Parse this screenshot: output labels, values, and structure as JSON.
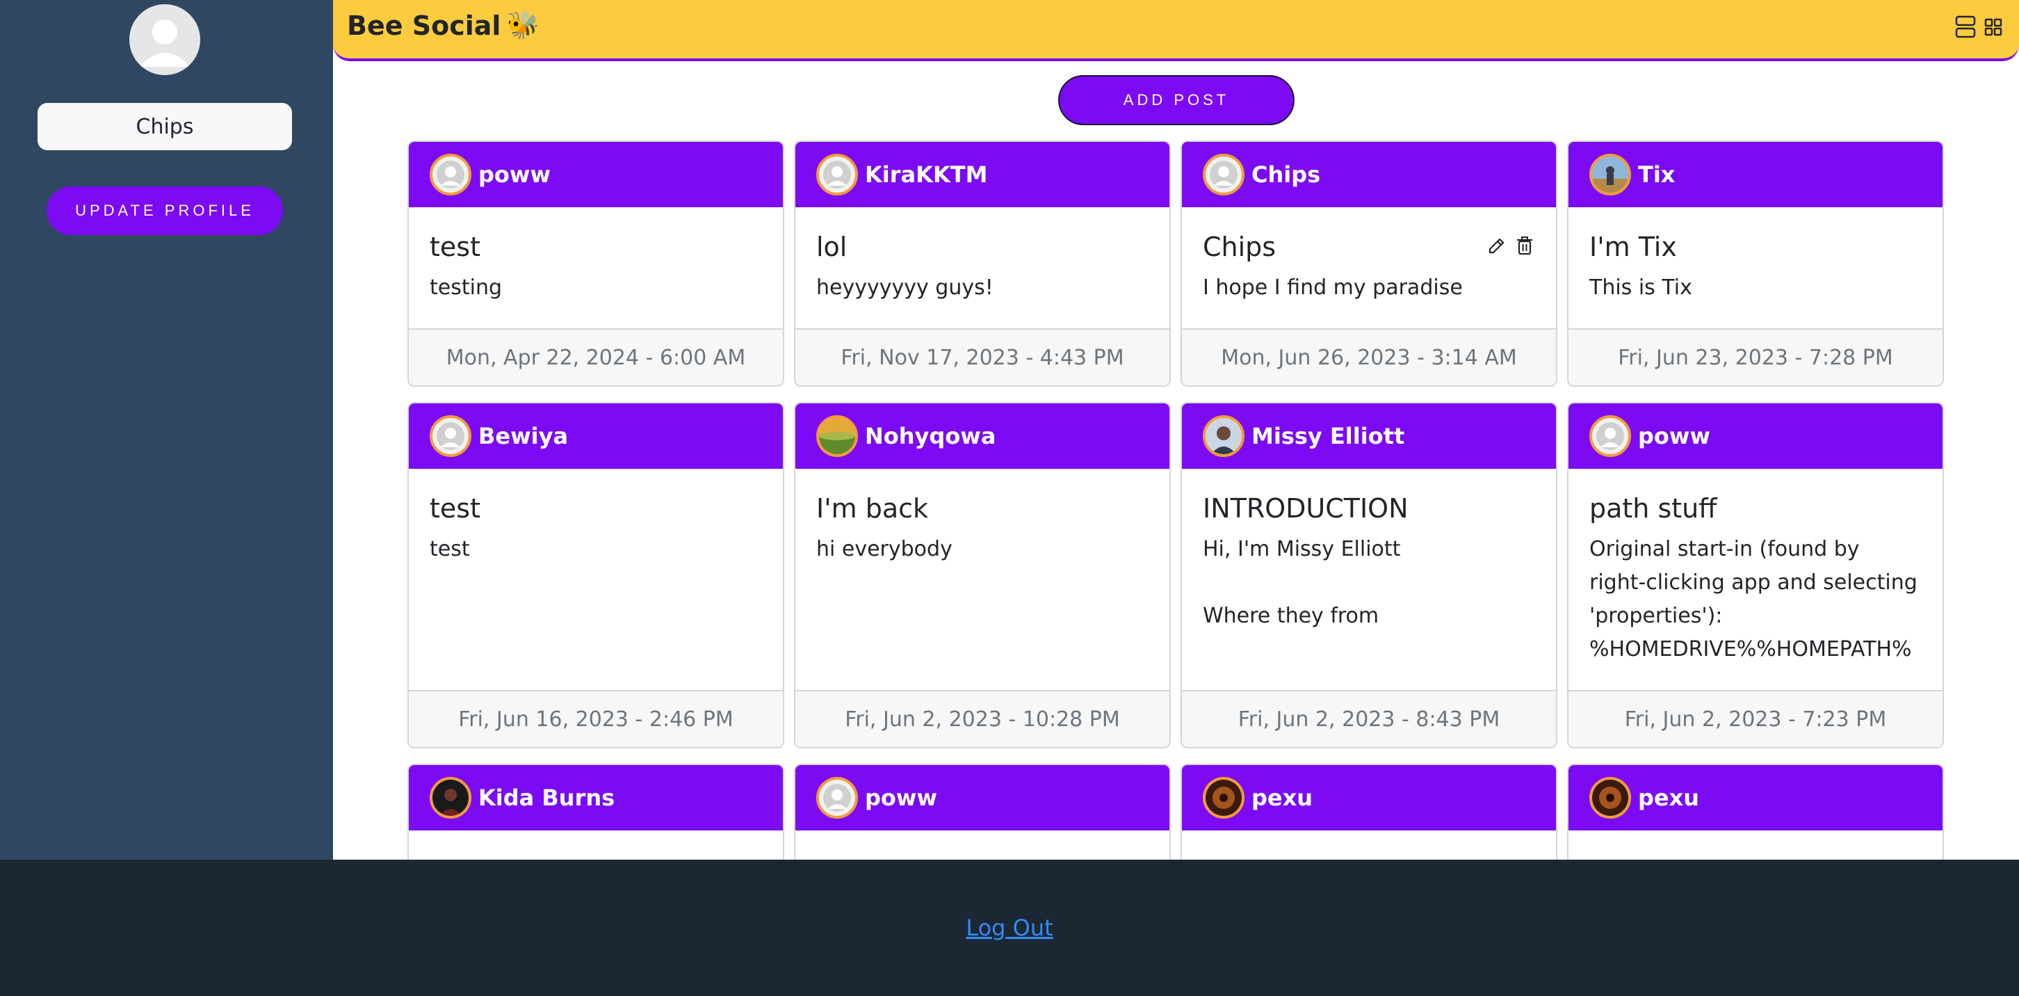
{
  "sidebar": {
    "username": "Chips",
    "update_label": "UPDATE PROFILE"
  },
  "header": {
    "brand": "Bee Social",
    "brand_emoji": "🐝"
  },
  "add_post_label": "ADD POST",
  "posts": [
    {
      "user": "poww",
      "title": "test",
      "text": "testing",
      "date": "Mon, Apr 22, 2024 - 6:00 AM",
      "avatar": "default"
    },
    {
      "user": "KiraKKTM",
      "title": "lol",
      "text": "heyyyyyyy guys!",
      "date": "Fri, Nov 17, 2023 - 4:43 PM",
      "avatar": "default"
    },
    {
      "user": "Chips",
      "title": "Chips",
      "text": "I hope I find my paradise",
      "date": "Mon, Jun 26, 2023 - 3:14 AM",
      "avatar": "default",
      "editable": true
    },
    {
      "user": "Tix",
      "title": "I'm Tix",
      "text": "This is Tix",
      "date": "Fri, Jun 23, 2023 - 7:28 PM",
      "avatar": "photo"
    },
    {
      "user": "Bewiya",
      "title": "test",
      "text": "test",
      "date": "Fri, Jun 16, 2023 - 2:46 PM",
      "avatar": "default"
    },
    {
      "user": "Nohyqowa",
      "title": "I'm back",
      "text": "hi everybody",
      "date": "Fri, Jun 2, 2023 - 10:28 PM",
      "avatar": "landscape"
    },
    {
      "user": "Missy Elliott",
      "title": "INTRODUCTION",
      "text": "Hi, I'm Missy Elliott\n\nWhere they from",
      "date": "Fri, Jun 2, 2023 - 8:43 PM",
      "avatar": "photo"
    },
    {
      "user": "poww",
      "title": "path stuff",
      "text": "Original start-in (found by right-clicking app and selecting 'properties'): %HOMEDRIVE%%HOMEPATH%",
      "date": "Fri, Jun 2, 2023 - 7:23 PM",
      "avatar": "default"
    },
    {
      "user": "Kida Burns",
      "title": "",
      "text": "",
      "date": "",
      "avatar": "dark"
    },
    {
      "user": "poww",
      "title": "",
      "text": "",
      "date": "",
      "avatar": "default"
    },
    {
      "user": "pexu",
      "title": "",
      "text": "",
      "date": "",
      "avatar": "dark"
    },
    {
      "user": "pexu",
      "title": "",
      "text": "",
      "date": "",
      "avatar": "dark"
    }
  ],
  "footer": {
    "logout_label": "Log Out"
  },
  "colors": {
    "primary": "#7c0af5",
    "header": "#fdcb3e",
    "sidebar": "#2f4760",
    "footer": "#1b2733",
    "link": "#2f8cf5"
  }
}
